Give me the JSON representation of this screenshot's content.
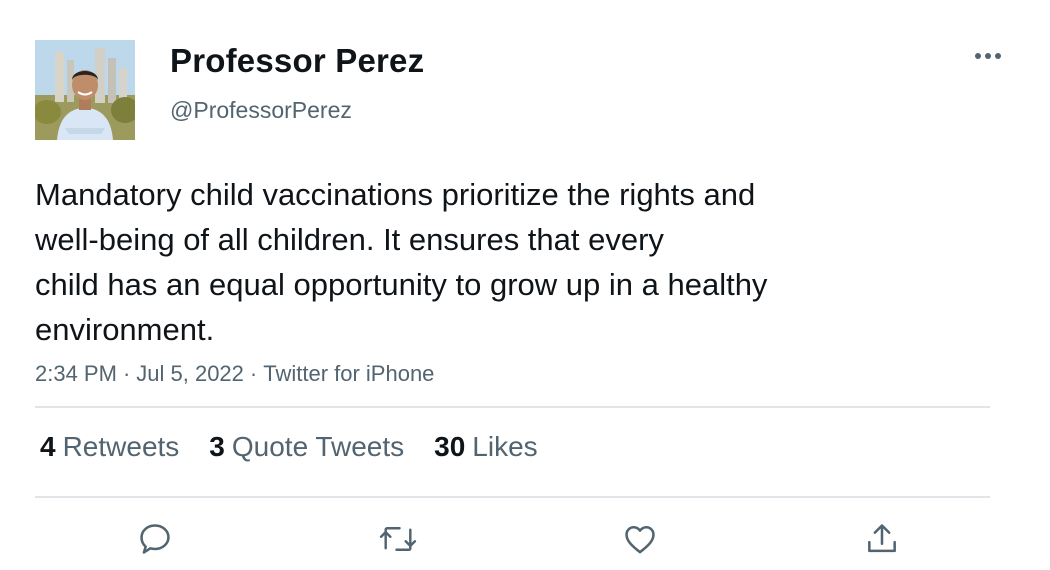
{
  "tweet": {
    "author": {
      "display_name": "Professor Perez",
      "handle": "@ProfessorPerez",
      "avatar_icon": "profile-photo"
    },
    "text_lines": [
      "Mandatory child vaccinations prioritize the rights and",
      "well-being of all children. It ensures that every",
      "child has an equal opportunity to grow up in a healthy",
      "environment."
    ],
    "meta": {
      "time": "2:34 PM",
      "date": "Jul 5, 2022",
      "source": "Twitter for iPhone",
      "separator": "·"
    },
    "stats": {
      "retweets": {
        "count": "4",
        "label": "Retweets"
      },
      "quote_tweets": {
        "count": "3",
        "label": "Quote Tweets"
      },
      "likes": {
        "count": "30",
        "label": "Likes"
      }
    },
    "actions": [
      "reply-icon",
      "retweet-icon",
      "like-icon",
      "share-icon"
    ]
  },
  "colors": {
    "text": "#0f1419",
    "secondary": "#536471",
    "divider": "#e1e4e8",
    "icon": "#536471"
  }
}
